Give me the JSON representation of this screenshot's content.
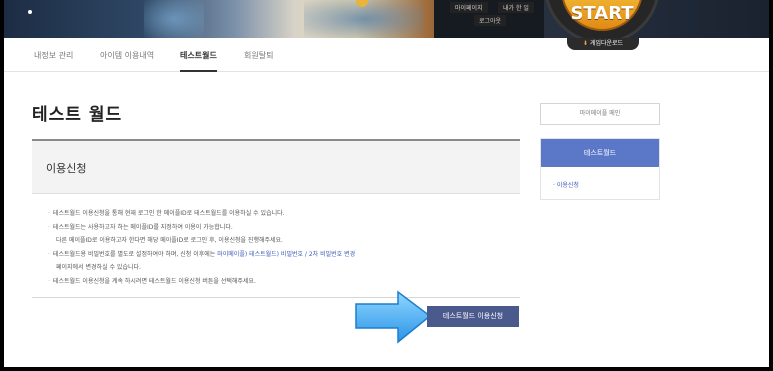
{
  "header": {
    "top_links": [
      "마이페이지",
      "내가 한 일",
      "로그아웃"
    ],
    "start_label": "START",
    "download_label": "게임다운로드"
  },
  "tabs": [
    {
      "label": "내정보 관리",
      "active": false
    },
    {
      "label": "아이템 이용내역",
      "active": false
    },
    {
      "label": "테스트월드",
      "active": true
    },
    {
      "label": "회원탈퇴",
      "active": false
    }
  ],
  "main": {
    "title": "테스트 월드",
    "section_title": "이용신청",
    "notices": [
      {
        "bullet": true,
        "parts": [
          {
            "t": "테스트월드 이용신청을 통해 현재 로그인 한 메이플ID로 테스트월드를 이용하실 수 있습니다."
          }
        ]
      },
      {
        "bullet": true,
        "parts": [
          {
            "t": "테스트월드는 사용하고자 하는 메이플ID를 지정하여 이용이 가능합니다."
          }
        ]
      },
      {
        "bullet": false,
        "parts": [
          {
            "t": "다른 메이플ID로 이용하고자 한다면 해당 메이플ID로 로그인 후, 이용신청을 진행해주세요."
          }
        ]
      },
      {
        "bullet": true,
        "parts": [
          {
            "t": "테스트월드용 비밀번호를 별도로 설정하여야 하며, 신청 이후에는 "
          },
          {
            "t": "마이메이플) 테스트월드) 비밀번호 / 2차 비밀번호 변경",
            "link": true
          }
        ]
      },
      {
        "bullet": false,
        "parts": [
          {
            "t": "페이지에서 변경하실 수 있습니다."
          }
        ]
      },
      {
        "bullet": true,
        "parts": [
          {
            "t": "테스트월드 이용신청을 계속 하시려면 테스트월드 이용신청 버튼을 선택해주세요."
          }
        ]
      }
    ],
    "apply_button": "테스트월드 이용신청"
  },
  "sidebar": {
    "maple_button": "마이메이플 메인",
    "panel_title": "테스트월드",
    "items": [
      "이용신청"
    ]
  },
  "colors": {
    "panel_header": "#5b77c8",
    "apply_button": "#4b5a8d",
    "link": "#3b5bb8",
    "arrow": "#3ea8ee"
  },
  "icons": [
    "download-icon",
    "right-arrow-icon",
    "coin-icon"
  ]
}
